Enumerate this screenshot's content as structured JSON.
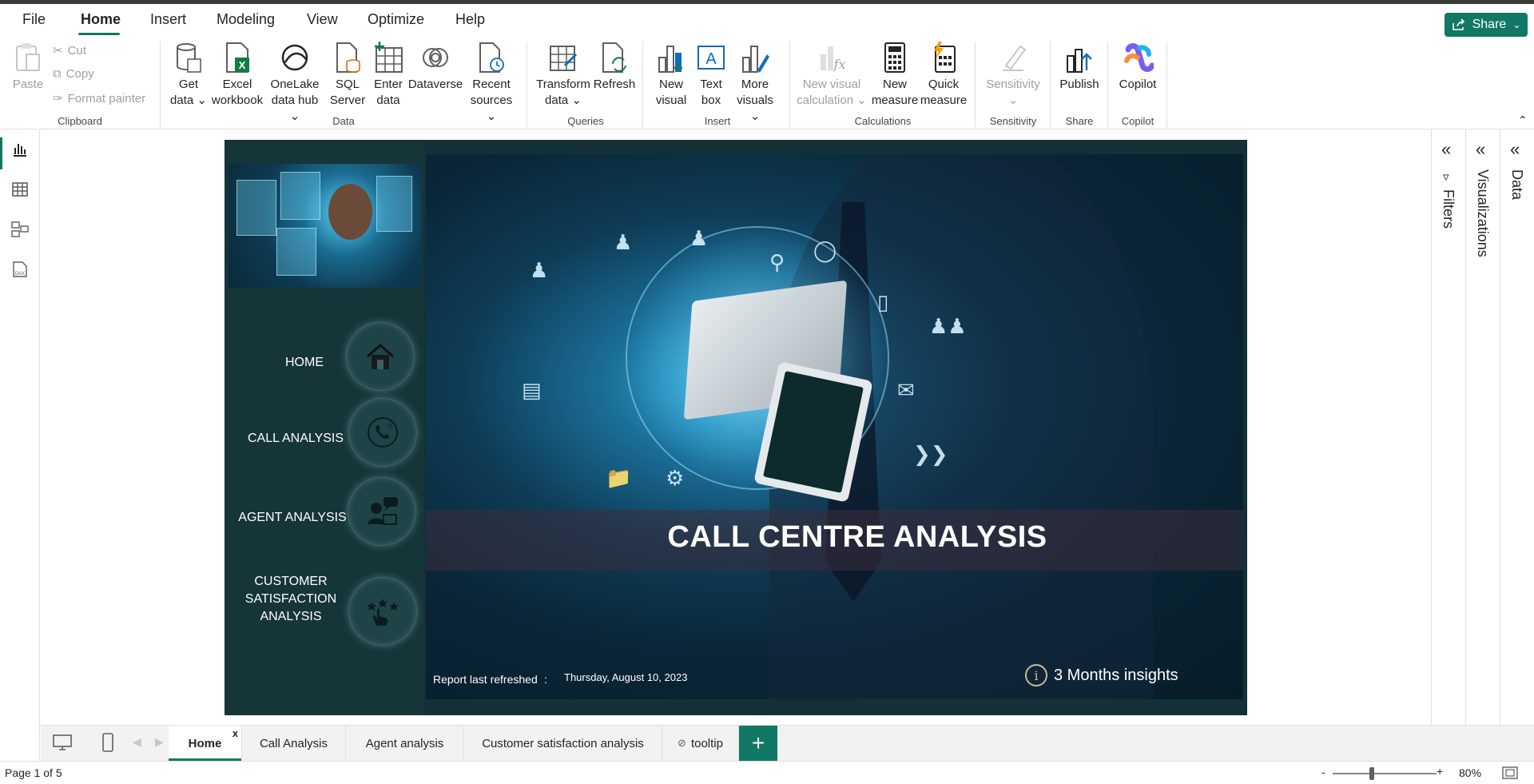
{
  "menu": {
    "items": [
      "File",
      "Home",
      "Insert",
      "Modeling",
      "View",
      "Optimize",
      "Help"
    ],
    "active": "Home",
    "share_label": "Share"
  },
  "ribbon": {
    "clipboard": {
      "paste": "Paste",
      "cut": "Cut",
      "copy": "Copy",
      "format_painter": "Format painter",
      "group": "Clipboard"
    },
    "data": {
      "get_data": [
        "Get",
        "data"
      ],
      "excel": [
        "Excel",
        "workbook"
      ],
      "onelake": [
        "OneLake",
        "data hub"
      ],
      "sql": [
        "SQL",
        "Server"
      ],
      "enter": [
        "Enter",
        "data"
      ],
      "dataverse": "Dataverse",
      "recent": [
        "Recent",
        "sources"
      ],
      "group": "Data"
    },
    "queries": {
      "transform": [
        "Transform",
        "data"
      ],
      "refresh": "Refresh",
      "group": "Queries"
    },
    "insert": {
      "new_visual": [
        "New",
        "visual"
      ],
      "text_box": [
        "Text",
        "box"
      ],
      "more_visuals": [
        "More",
        "visuals"
      ],
      "group": "Insert"
    },
    "calculations": {
      "new_visual_calc": [
        "New visual",
        "calculation"
      ],
      "new_measure": [
        "New",
        "measure"
      ],
      "quick_measure": [
        "Quick",
        "measure"
      ],
      "group": "Calculations"
    },
    "sensitivity": {
      "label": "Sensitivity",
      "group": "Sensitivity"
    },
    "share": {
      "publish": "Publish",
      "group": "Share"
    },
    "copilot": {
      "label": "Copilot",
      "group": "Copilot"
    }
  },
  "report": {
    "nav": [
      {
        "label": "HOME",
        "icon": "house-icon"
      },
      {
        "label": "CALL ANALYSIS",
        "icon": "phone-question-icon"
      },
      {
        "label": "AGENT ANALYSIS",
        "icon": "agent-chat-icon"
      },
      {
        "label": "CUSTOMER SATISFACTION ANALYSIS",
        "lines": [
          "CUSTOMER",
          "SATISFACTION",
          "ANALYSIS"
        ],
        "icon": "hand-stars-icon"
      }
    ],
    "title": "CALL CENTRE ANALYSIS",
    "refresh_label": "Report last refreshed",
    "refresh_colon": ":",
    "refresh_date": "Thursday, August 10, 2023",
    "insight_label": "3 Months insights"
  },
  "right_panes": {
    "filters": "Filters",
    "visualizations": "Visualizations",
    "data": "Data"
  },
  "pages": {
    "tabs": [
      "Home",
      "Call Analysis",
      "Agent analysis",
      "Customer satisfaction analysis",
      "tooltip"
    ],
    "active": "Home",
    "close_glyph": "x",
    "add_glyph": "+"
  },
  "status": {
    "page_info": "Page 1 of 5",
    "zoom": "80%",
    "zoom_minus": "-",
    "zoom_plus": "+"
  },
  "colors": {
    "accent": "#117865",
    "report_bg": "#133136",
    "nav_bg": "#163539"
  }
}
